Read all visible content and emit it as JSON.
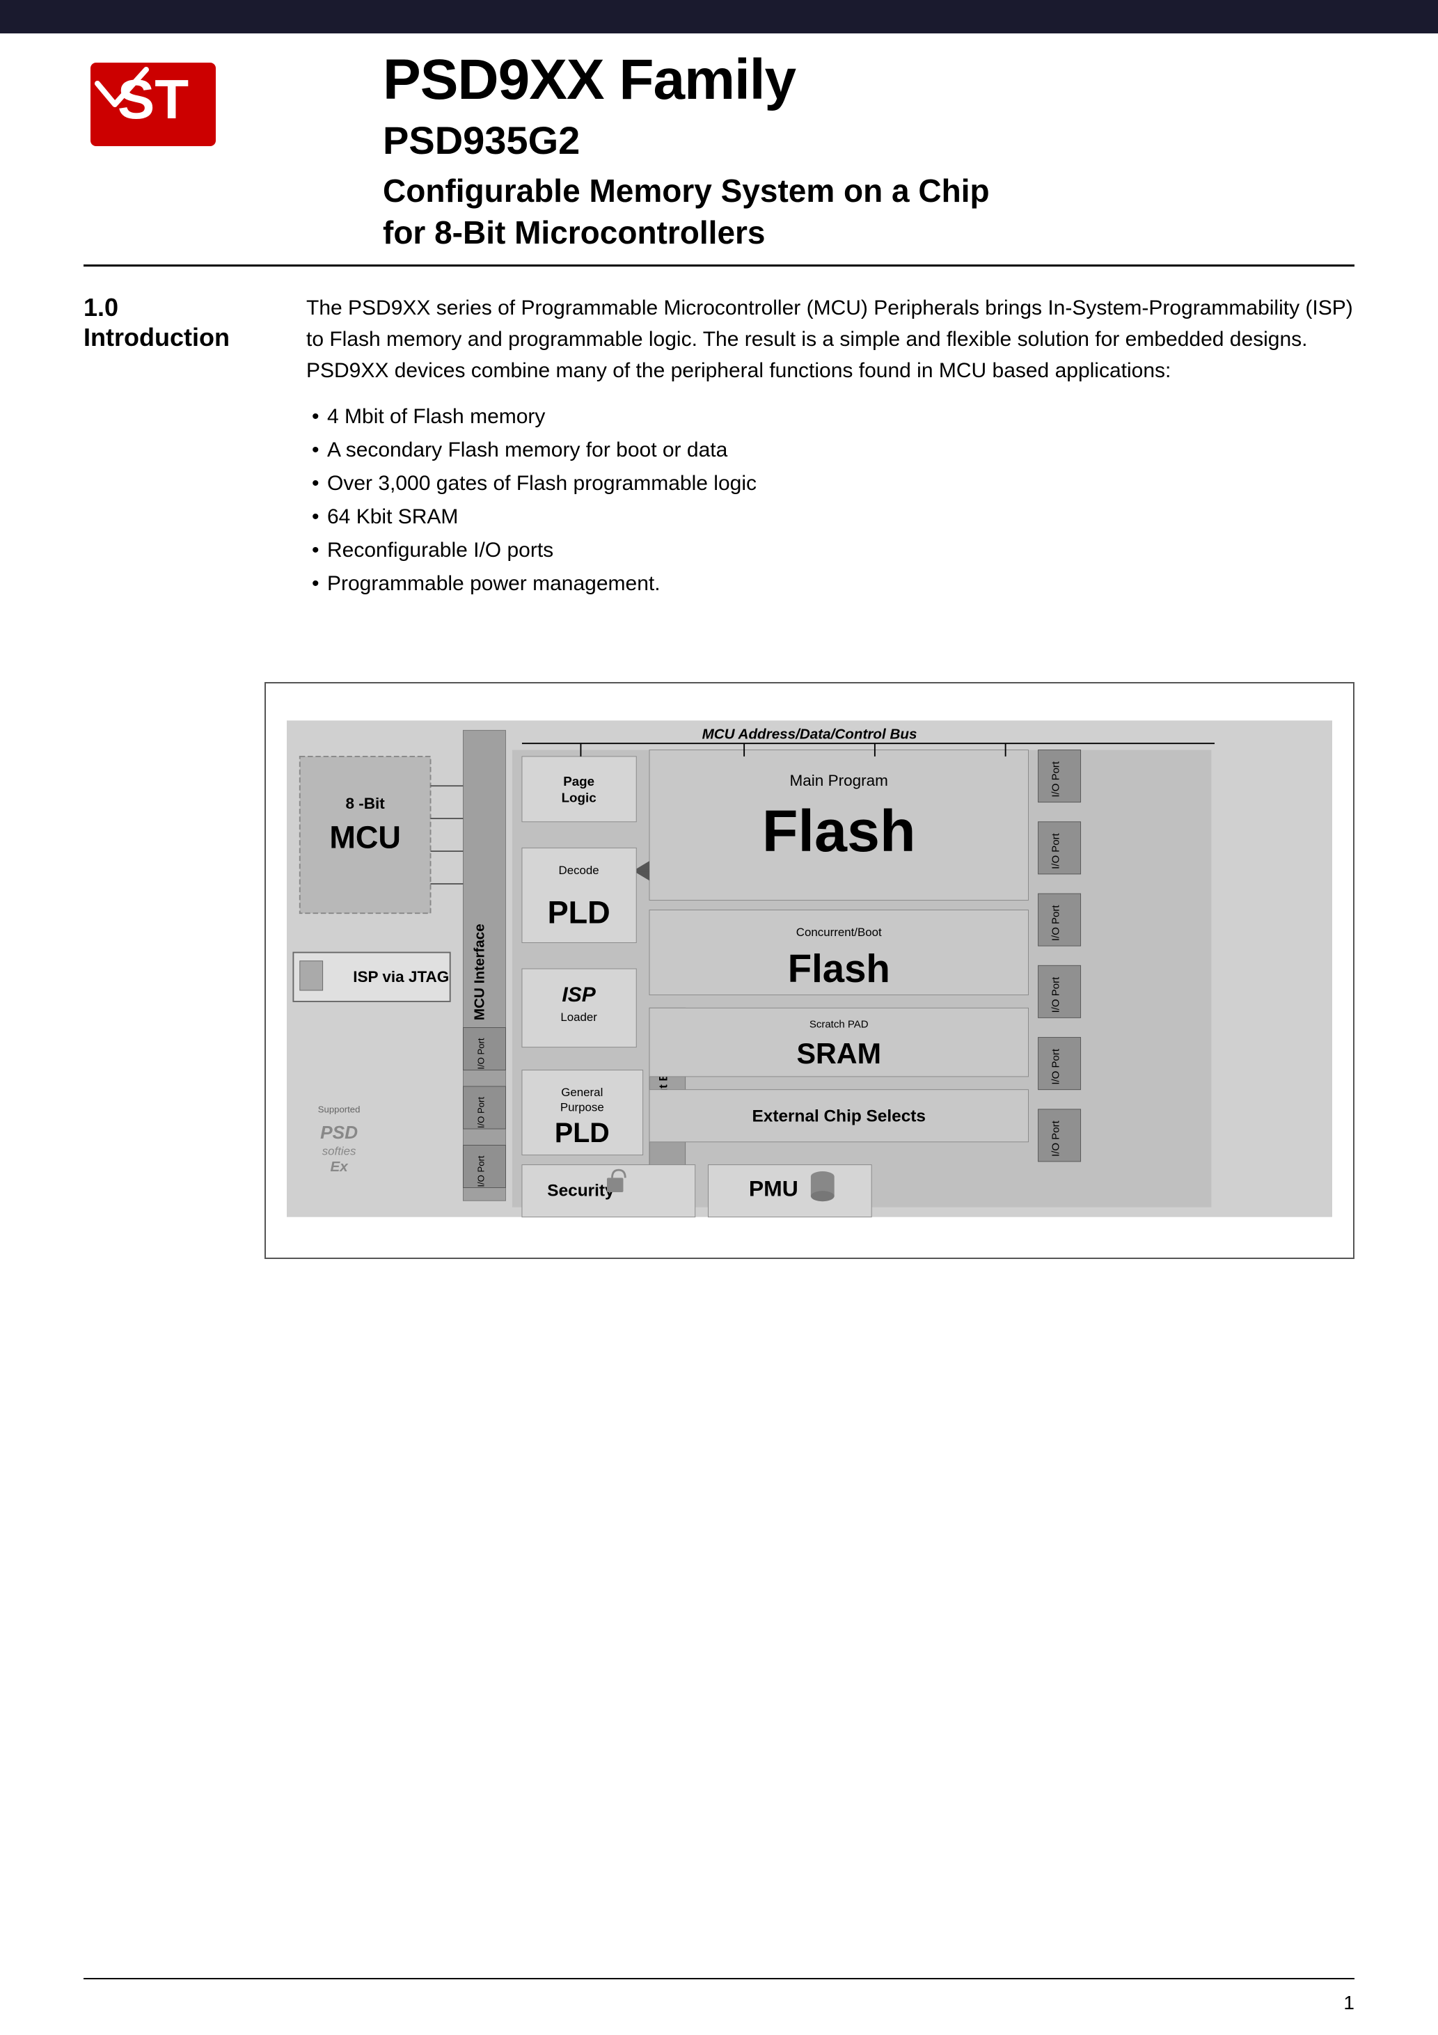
{
  "header": {
    "bar_color": "#1a1a2e"
  },
  "logo": {
    "alt": "ST Microelectronics Logo"
  },
  "title": {
    "family": "PSD9XX Family",
    "product": "PSD935G2",
    "description_line1": "Configurable Memory System on a Chip",
    "description_line2": "for 8-Bit Microcontrollers"
  },
  "section": {
    "number": "1.0",
    "name": "Introduction",
    "intro_paragraph": "The PSD9XX series of Programmable Microcontroller (MCU) Peripherals brings In-System-Programmability (ISP) to Flash memory and programmable logic. The result is a simple and flexible solution for embedded designs. PSD9XX devices combine many of the peripheral functions found in MCU based applications:",
    "bullets": [
      "4 Mbit of Flash memory",
      "A secondary Flash memory for boot or data",
      "Over 3,000 gates of Flash programmable logic",
      "64 Kbit SRAM",
      "Reconfigurable I/O ports",
      "Programmable power management."
    ]
  },
  "diagram": {
    "bus_label": "MCU Address/Data/Control Bus",
    "mcu_label_top": "8 -Bit",
    "mcu_label_main": "MCU",
    "isp_jtag_label": "ISP via JTAG",
    "mcu_interface_label": "MCU Interface",
    "pld_input_bus_label": "PLD Input Bus",
    "page_logic_label": "Page\nLogic",
    "main_program_label": "Main Program",
    "flash_label": "Flash",
    "decode_label": "Decode",
    "pld_label": "PLD",
    "isp_label": "ISP",
    "loader_label": "Loader",
    "concurrent_boot_label": "Concurrent/Boot",
    "boot_flash_label": "Flash",
    "scratch_pad_label": "Scratch PAD",
    "sram_label": "SRAM",
    "general_purpose_label": "General\nPurpose",
    "gp_pld_label": "PLD",
    "external_chip_selects_label": "External Chip Selects",
    "security_label": "Security",
    "pmu_label": "PMU",
    "io_port_label": "I/O Port",
    "io_ports": [
      "I/O Port",
      "I/O Port",
      "I/O Port",
      "I/O Port",
      "I/O Port",
      "I/O Port"
    ]
  },
  "footer": {
    "page_number": "1"
  }
}
